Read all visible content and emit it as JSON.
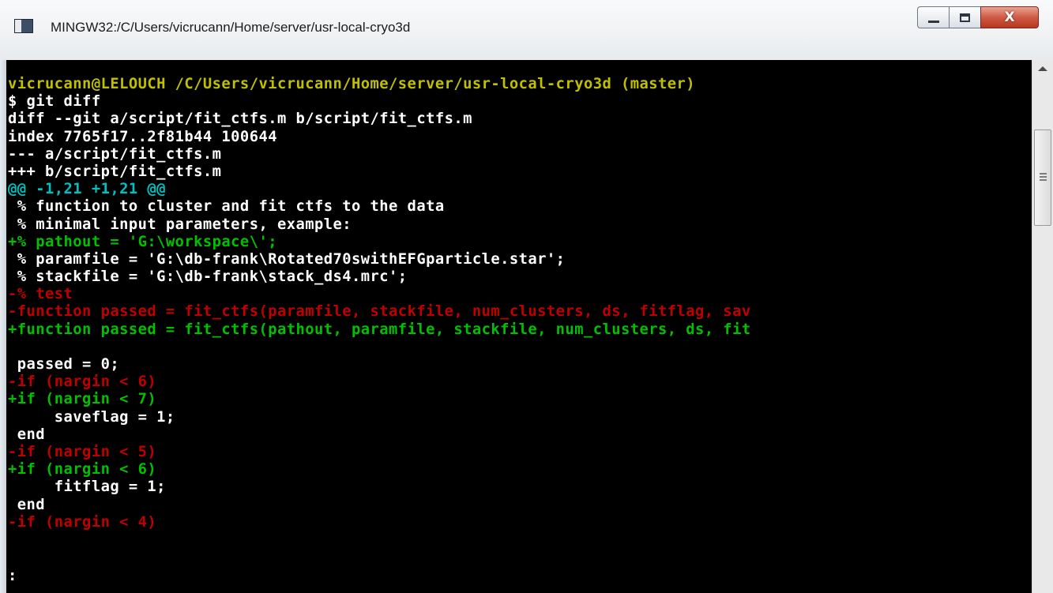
{
  "window": {
    "title": "MINGW32:/C/Users/vicrucann/Home/server/usr-local-cryo3d",
    "close_glyph": "X",
    "buttons": [
      "minimize",
      "maximize",
      "close"
    ]
  },
  "colors": {
    "background": "#000000",
    "default_text": "#ffffff",
    "prompt": "#c0c000",
    "hunk": "#00c0c0",
    "added": "#00c000",
    "removed": "#c00000",
    "close_button": "#c94a36"
  },
  "terminal": {
    "lines": [
      [
        {
          "t": "vicrucann@LELOUCH /C/Users/vicrucann/Home/server/usr-local-cryo3d (master)",
          "c": "prompt"
        }
      ],
      [
        {
          "t": "$ git diff",
          "c": "default_text"
        }
      ],
      [
        {
          "t": "diff --git a/script/fit_ctfs.m b/script/fit_ctfs.m",
          "c": "default_text"
        }
      ],
      [
        {
          "t": "index 7765f17..2f81b44 100644",
          "c": "default_text"
        }
      ],
      [
        {
          "t": "--- a/script/fit_ctfs.m",
          "c": "default_text"
        }
      ],
      [
        {
          "t": "+++ b/script/fit_ctfs.m",
          "c": "default_text"
        }
      ],
      [
        {
          "t": "@@ -1,21 +1,21 @@",
          "c": "hunk"
        }
      ],
      [
        {
          "t": " % function to cluster and fit ctfs to the data",
          "c": "default_text"
        }
      ],
      [
        {
          "t": " % minimal input parameters, example:",
          "c": "default_text"
        }
      ],
      [
        {
          "t": "+% pathout = 'G:\\workspace\\';",
          "c": "added"
        }
      ],
      [
        {
          "t": " % paramfile = 'G:\\db-frank\\Rotated70swithEFGparticle.star';",
          "c": "default_text"
        }
      ],
      [
        {
          "t": " % stackfile = 'G:\\db-frank\\stack_ds4.mrc';",
          "c": "default_text"
        }
      ],
      [
        {
          "t": "-% test",
          "c": "removed"
        }
      ],
      [
        {
          "t": "-function passed = ",
          "c": "removed"
        },
        {
          "t": "fit_ctfs(paramfile, stackfile, num_clusters, ds, fitflag, sav",
          "c": "removed"
        }
      ],
      [
        {
          "t": "+function passed = ",
          "c": "added"
        },
        {
          "t": "fit_ctfs(pathout, paramfile, stackfile, num_clusters, ds, fit",
          "c": "added"
        }
      ],
      [
        {
          "t": "",
          "c": "default_text"
        }
      ],
      [
        {
          "t": " passed = 0;",
          "c": "default_text"
        }
      ],
      [
        {
          "t": "-if (nargin < 6)",
          "c": "removed"
        }
      ],
      [
        {
          "t": "+if (nargin < 7)",
          "c": "added"
        }
      ],
      [
        {
          "t": "     saveflag = 1;",
          "c": "default_text"
        }
      ],
      [
        {
          "t": " end",
          "c": "default_text"
        }
      ],
      [
        {
          "t": "-if (nargin < 5)",
          "c": "removed"
        }
      ],
      [
        {
          "t": "+if (nargin < 6)",
          "c": "added"
        }
      ],
      [
        {
          "t": "     fitflag = 1;",
          "c": "default_text"
        }
      ],
      [
        {
          "t": " end",
          "c": "default_text"
        }
      ],
      [
        {
          "t": "-if (nargin < 4)",
          "c": "removed"
        }
      ]
    ],
    "pager_prompt": ":"
  },
  "scrollbar": {
    "up_arrow": "scroll-up",
    "thumb_grip": "grip"
  }
}
